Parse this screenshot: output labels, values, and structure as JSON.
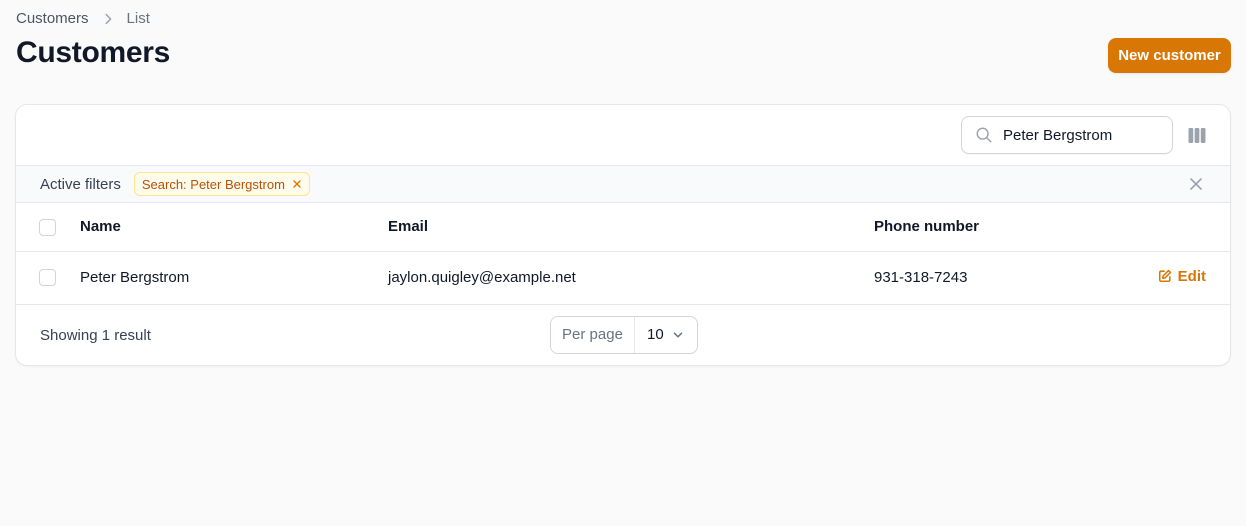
{
  "breadcrumb": {
    "items": [
      "Customers",
      "List"
    ]
  },
  "header": {
    "title": "Customers",
    "new_button_label": "New customer"
  },
  "toolbar": {
    "search_value": "Peter Bergstrom",
    "search_placeholder": "Search"
  },
  "filters": {
    "label": "Active filters",
    "chips": [
      "Search: Peter Bergstrom"
    ]
  },
  "table": {
    "columns": [
      "Name",
      "Email",
      "Phone number"
    ],
    "rows": [
      {
        "name": "Peter Bergstrom",
        "email": "jaylon.quigley@example.net",
        "phone": "931-318-7243",
        "action_label": "Edit"
      }
    ]
  },
  "footer": {
    "result_text": "Showing 1 result",
    "per_page_label": "Per page",
    "per_page_value": "10"
  },
  "colors": {
    "accent": "#d97706",
    "chip_bg": "#fffbeb",
    "chip_text": "#b45309"
  },
  "icons": {
    "breadcrumb_separator": "chevron-right-icon",
    "search": "search-icon",
    "columns": "columns-icon",
    "chip_remove": "close-icon",
    "clear_filters": "close-icon",
    "edit": "edit-icon",
    "per_page_dropdown": "chevron-down-icon"
  }
}
